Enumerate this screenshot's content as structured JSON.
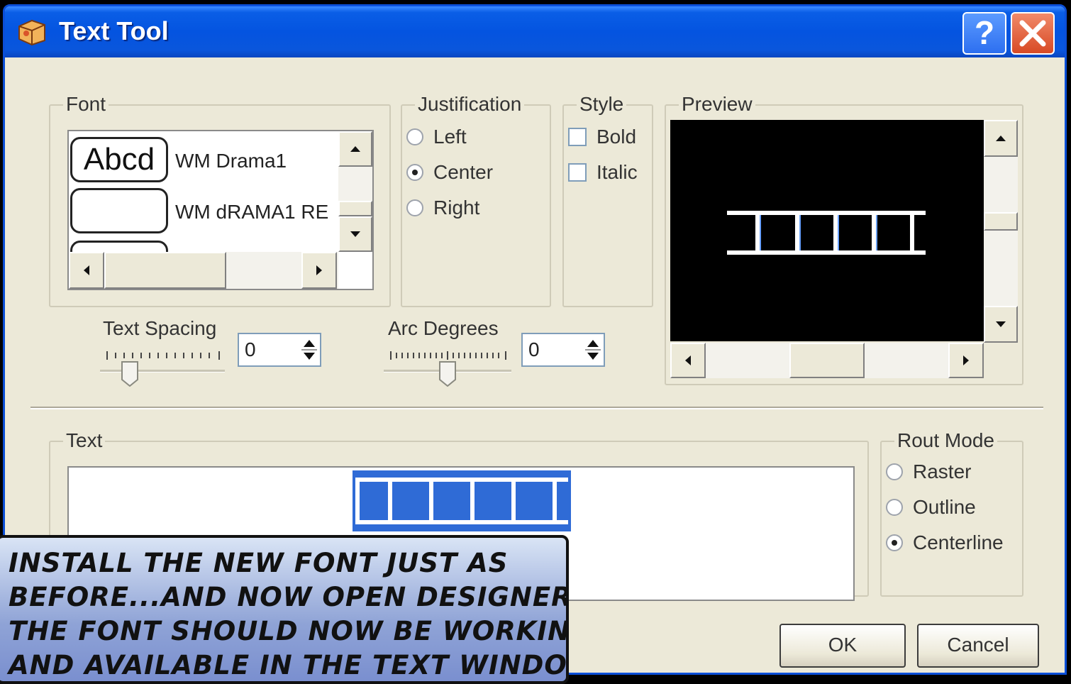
{
  "window": {
    "title": "Text Tool"
  },
  "titlebar": {
    "help_label": "?",
    "icons": [
      "app-icon",
      "help-icon",
      "close-icon"
    ]
  },
  "font_group": {
    "legend": "Font",
    "items": [
      {
        "sample": "Abcd",
        "name": "WM Drama1"
      },
      {
        "sample": "",
        "name": "WM dRAMA1 RE"
      }
    ],
    "icons": [
      "scroll-up-icon",
      "scroll-down-icon",
      "scroll-left-icon",
      "scroll-right-icon"
    ]
  },
  "justification": {
    "legend": "Justification",
    "options": [
      {
        "label": "Left",
        "selected": false
      },
      {
        "label": "Center",
        "selected": true
      },
      {
        "label": "Right",
        "selected": false
      }
    ]
  },
  "style": {
    "legend": "Style",
    "options": [
      {
        "label": "Bold",
        "checked": false
      },
      {
        "label": "Italic",
        "checked": false
      }
    ]
  },
  "preview": {
    "legend": "Preview"
  },
  "text_spacing": {
    "label": "Text Spacing",
    "value": "0"
  },
  "arc_degrees": {
    "label": "Arc Degrees",
    "value": "0"
  },
  "text_group": {
    "legend": "Text"
  },
  "rout_mode": {
    "legend": "Rout Mode",
    "options": [
      {
        "label": "Raster",
        "selected": false
      },
      {
        "label": "Outline",
        "selected": false
      },
      {
        "label": "Centerline",
        "selected": true
      }
    ]
  },
  "buttons": {
    "ok_label": "OK",
    "cancel_label": "Cancel"
  },
  "caption": {
    "lines": [
      "INSTALL THE NEW FONT JUST AS",
      "BEFORE...AND NOW OPEN DESIGNER.",
      "THE FONT SHOULD NOW BE WORKING",
      "AND AVAILABLE IN THE TEXT WINDOW."
    ]
  },
  "colors": {
    "title_bar": "#0454e0",
    "dialog_bg": "#ece9d8",
    "selection": "#2f6bd6",
    "close_button": "#d84a25",
    "caption_bg": "#8fa3d6"
  }
}
